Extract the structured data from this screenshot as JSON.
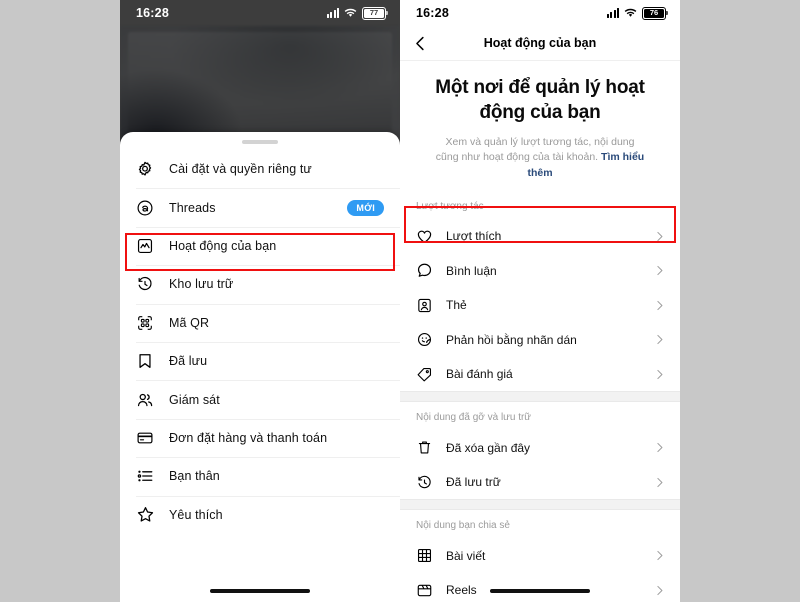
{
  "left_phone": {
    "status_bar": {
      "time": "16:28",
      "battery": "77",
      "signal_icon": "cellular-signal-icon",
      "wifi_icon": "wifi-icon",
      "battery_icon": "battery-icon"
    },
    "sheet": {
      "grabber": "drag-handle",
      "items": [
        {
          "icon": "gear-settings-icon",
          "label": "Cài đặt và quyền riêng tư",
          "badge": ""
        },
        {
          "icon": "threads-icon",
          "label": "Threads",
          "badge": "MỚI"
        },
        {
          "icon": "activity-chart-icon",
          "label": "Hoạt động của bạn",
          "badge": ""
        },
        {
          "icon": "archive-clock-icon",
          "label": "Kho lưu trữ",
          "badge": ""
        },
        {
          "icon": "qr-code-icon",
          "label": "Mã QR",
          "badge": ""
        },
        {
          "icon": "bookmark-icon",
          "label": "Đã lưu",
          "badge": ""
        },
        {
          "icon": "supervision-people-icon",
          "label": "Giám sát",
          "badge": ""
        },
        {
          "icon": "credit-card-icon",
          "label": "Đơn đặt hàng và thanh toán",
          "badge": ""
        },
        {
          "icon": "close-friends-list-icon",
          "label": "Bạn thân",
          "badge": ""
        },
        {
          "icon": "star-icon",
          "label": "Yêu thích",
          "badge": ""
        }
      ],
      "highlighted_item_index": 2
    },
    "home_indicator": "home-bar"
  },
  "right_phone": {
    "status_bar": {
      "time": "16:28",
      "battery": "76",
      "signal_icon": "cellular-signal-icon",
      "wifi_icon": "wifi-icon",
      "battery_icon": "battery-icon"
    },
    "nav": {
      "back_icon": "back-chevron-icon",
      "title": "Hoạt động của bạn"
    },
    "hero": {
      "title": "Một nơi để quản lý hoạt động của bạn",
      "description": "Xem và quản lý lượt tương tác, nội dung cũng như hoạt động của tài khoản. ",
      "link": "Tìm hiểu thêm"
    },
    "sections": [
      {
        "header": "Lượt tương tác",
        "items": [
          {
            "icon": "heart-icon",
            "label": "Lượt thích",
            "chevron": "chevron-right-icon",
            "highlighted": true
          },
          {
            "icon": "comment-bubble-icon",
            "label": "Bình luận",
            "chevron": "chevron-right-icon",
            "highlighted": false
          },
          {
            "icon": "tag-card-icon",
            "label": "Thẻ",
            "chevron": "chevron-right-icon",
            "highlighted": false
          },
          {
            "icon": "sticker-smiley-icon",
            "label": "Phản hồi bằng nhãn dán",
            "chevron": "chevron-right-icon",
            "highlighted": false
          },
          {
            "icon": "review-tag-icon",
            "label": "Bài đánh giá",
            "chevron": "chevron-right-icon",
            "highlighted": false
          }
        ]
      },
      {
        "header": "Nội dung đã gỡ và lưu trữ",
        "items": [
          {
            "icon": "trash-icon",
            "label": "Đã xóa gần đây",
            "chevron": "chevron-right-icon",
            "highlighted": false
          },
          {
            "icon": "archive-clock-icon",
            "label": "Đã lưu trữ",
            "chevron": "chevron-right-icon",
            "highlighted": false
          }
        ]
      },
      {
        "header": "Nội dung bạn chia sẻ",
        "items": [
          {
            "icon": "grid-posts-icon",
            "label": "Bài viết",
            "chevron": "chevron-right-icon",
            "highlighted": false
          },
          {
            "icon": "reels-clapper-icon",
            "label": "Reels",
            "chevron": "chevron-right-icon",
            "highlighted": false
          }
        ]
      }
    ],
    "home_indicator": "home-bar"
  },
  "colors": {
    "highlight_red": "#f01010",
    "badge_blue": "#2f9bf3",
    "link_blue": "#2a4a7a",
    "page_background": "#c8c8c8"
  }
}
